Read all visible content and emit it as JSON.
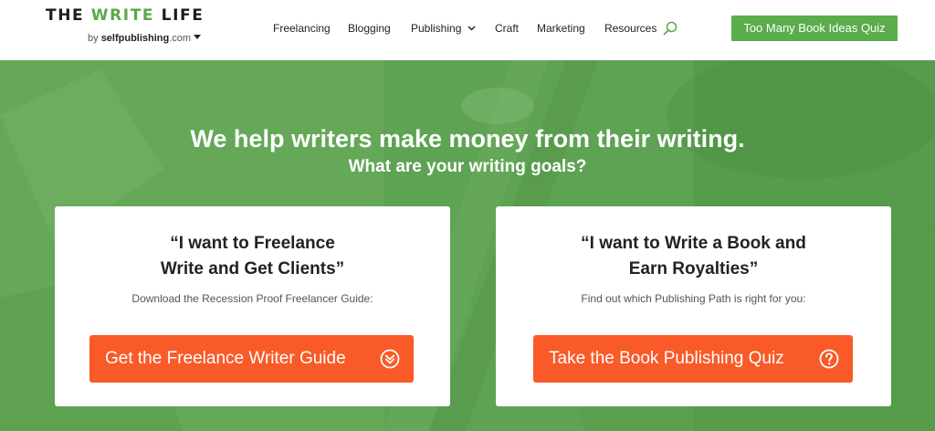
{
  "logo": {
    "part1": "THE ",
    "part2": "WRITE",
    "part3": " LIFE",
    "by": "by ",
    "brand_bold": "selfpublishing",
    "brand_tld": ".com"
  },
  "nav": {
    "items": [
      "Freelancing",
      "Blogging",
      "Publishing",
      "Craft",
      "Marketing",
      "Resources"
    ]
  },
  "header_cta": "Too Many Book Ideas Quiz",
  "hero": {
    "title": "We help writers make money from their writing.",
    "subtitle": "What are your writing goals?"
  },
  "cards": [
    {
      "quote_line1": "“I want to Freelance",
      "quote_line2": "Write and Get Clients”",
      "description": "Download the Recession Proof Freelancer Guide:",
      "button": "Get the Freelance Writer Guide",
      "icon": "chevron-double-down-circle-icon"
    },
    {
      "quote_line1": "“I want to Write a Book and",
      "quote_line2": "Earn Royalties”",
      "description": "Find out which Publishing Path is right for you:",
      "button": "Take the Book Publishing Quiz",
      "icon": "question-circle-icon"
    }
  ],
  "colors": {
    "brand_green": "#5aad4a",
    "hero_green": "#5da152",
    "cta_orange": "#f95a28",
    "text_dark": "#222222"
  }
}
